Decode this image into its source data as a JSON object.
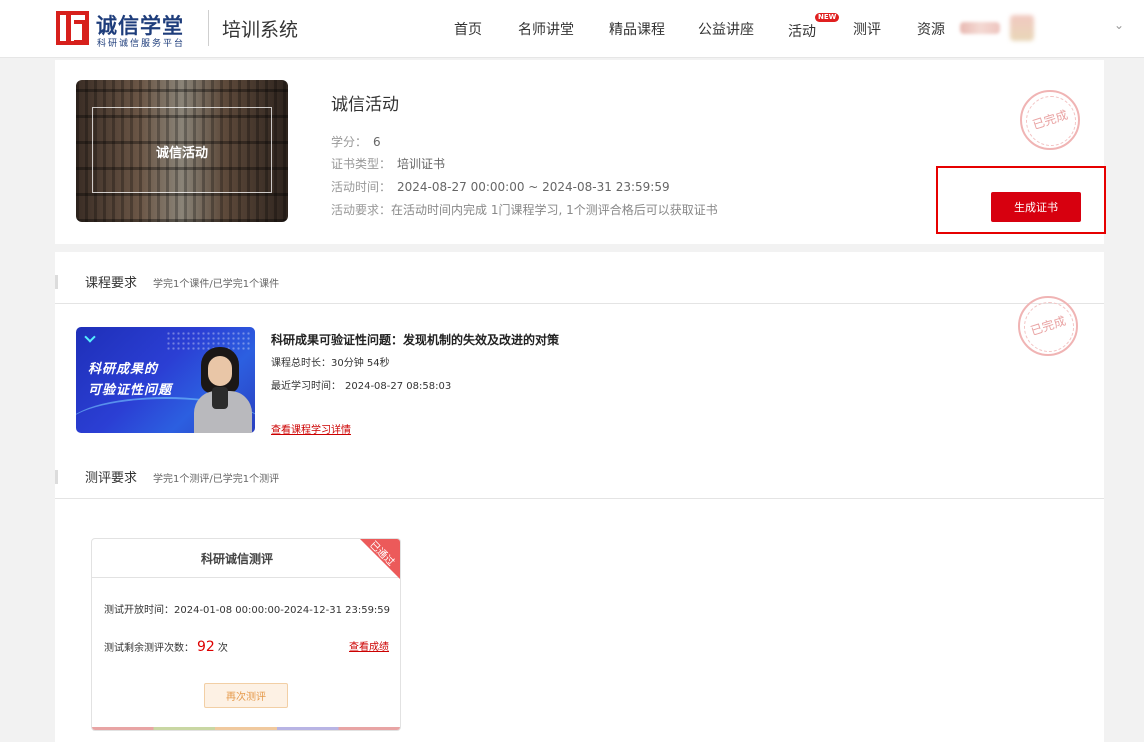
{
  "header": {
    "logo_title": "诚信学堂",
    "logo_subtitle": "科研诚信服务平台",
    "system_name": "培训系统",
    "nav": [
      {
        "label": "首页"
      },
      {
        "label": "名师讲堂"
      },
      {
        "label": "精品课程"
      },
      {
        "label": "公益讲座"
      },
      {
        "label": "活动",
        "badge": "NEW"
      },
      {
        "label": "测评"
      },
      {
        "label": "资源"
      }
    ],
    "user_menu_icon": "chevron-down-icon"
  },
  "activity": {
    "cover_text": "诚信活动",
    "title": "诚信活动",
    "credit_label": "学分：",
    "credit_value": "6",
    "cert_type_label": "证书类型：",
    "cert_type_value": "培训证书",
    "time_label": "活动时间：",
    "time_value": "2024-08-27 00:00:00 ~ 2024-08-31 23:59:59",
    "requirement_label": "活动要求：",
    "requirement_value": "在活动时间内完成 1门课程学习, 1个测评合格后可以获取证书",
    "stamp_text": "已完成",
    "generate_cert_label": "生成证书"
  },
  "course_section": {
    "title": "课程要求",
    "subtitle": "学完1个课件/已学完1个课件",
    "stamp_text": "已完成",
    "course": {
      "thumb_line1": "科研成果的",
      "thumb_line2": "可验证性问题",
      "title": "科研成果可验证性问题：发现机制的失效及改进的对策",
      "duration_label": "课程总时长：",
      "duration_value": "30分钟 54秒",
      "last_study_label": "最近学习时间：",
      "last_study_value": "2024-08-27 08:58:03",
      "detail_link": "查看课程学习详情"
    }
  },
  "eval_section": {
    "title": "测评要求",
    "subtitle": "学完1个测评/已学完1个测评",
    "card": {
      "title": "科研诚信测评",
      "ribbon": "已通过",
      "open_time_label": "测试开放时间：",
      "open_time_value": "2024-01-08 00:00:00-2024-12-31 23:59:59",
      "remaining_label": "测试剩余测评次数：",
      "remaining_count": "92",
      "remaining_unit": "次",
      "view_result_link": "查看成绩",
      "retake_label": "再次测评"
    }
  },
  "colors": {
    "brand_red": "#d7000f",
    "logo_blue": "#1e3d7b",
    "link_red": "#cc0000"
  }
}
